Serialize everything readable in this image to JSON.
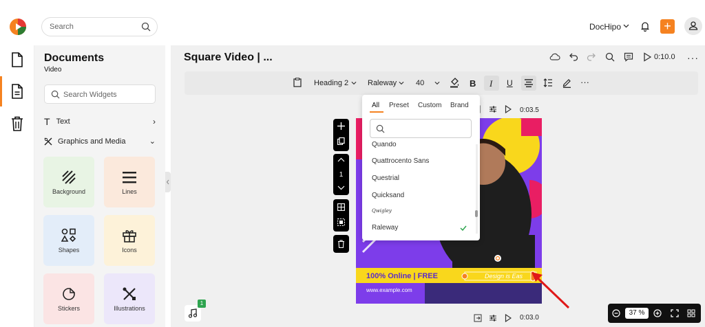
{
  "header": {
    "search_placeholder": "Search",
    "account_name": "DocHipo",
    "new_button": "+"
  },
  "sidebar": {
    "title": "Documents",
    "subtitle": "Video",
    "widget_search_placeholder": "Search Widgets",
    "categories": [
      {
        "label": "Text",
        "chevron": "›"
      },
      {
        "label": "Graphics and Media",
        "chevron": "⌄"
      }
    ],
    "tiles": [
      {
        "label": "Background",
        "icon": "background-icon",
        "color": "#e8f4e4"
      },
      {
        "label": "Lines",
        "icon": "lines-icon",
        "color": "#fbe9dc"
      },
      {
        "label": "Shapes",
        "icon": "shapes-icon",
        "color": "#e3edf9"
      },
      {
        "label": "Icons",
        "icon": "gift-icon",
        "color": "#fdf2d9"
      },
      {
        "label": "Stickers",
        "icon": "sticker-icon",
        "color": "#fbe4e4"
      },
      {
        "label": "Illustrations",
        "icon": "illustrations-icon",
        "color": "#ece7fa"
      }
    ]
  },
  "editor": {
    "doc_title": "Square Video | ...",
    "duration": "0:10.0",
    "more": "···"
  },
  "toolbar": {
    "heading": "Heading 2",
    "font": "Raleway",
    "size": "40",
    "bold": "B",
    "italic": "I",
    "underline": "U",
    "more": "···"
  },
  "mini_toolbar": {
    "time": "0:03.5",
    "page_number": "1"
  },
  "font_dropdown": {
    "tabs": [
      "All",
      "Preset",
      "Custom",
      "Brand"
    ],
    "active_tab": "All",
    "fonts": [
      "Quando",
      "Quattrocento Sans",
      "Questrial",
      "Quicksand",
      "Qwigley",
      "Raleway"
    ],
    "selected_font": "Raleway"
  },
  "canvas": {
    "offer": "100% Online | FREE",
    "website": "www.example.com",
    "tagline": "Design is Eas"
  },
  "bottom": {
    "audio_count": "1",
    "time": "0:03.0",
    "zoom": "37 %"
  },
  "colors": {
    "accent": "#f58220",
    "canvas_purple": "#7d3dea",
    "canvas_yellow": "#f9d71c",
    "canvas_pink": "#e91e63",
    "check_green": "#2ea44f"
  }
}
